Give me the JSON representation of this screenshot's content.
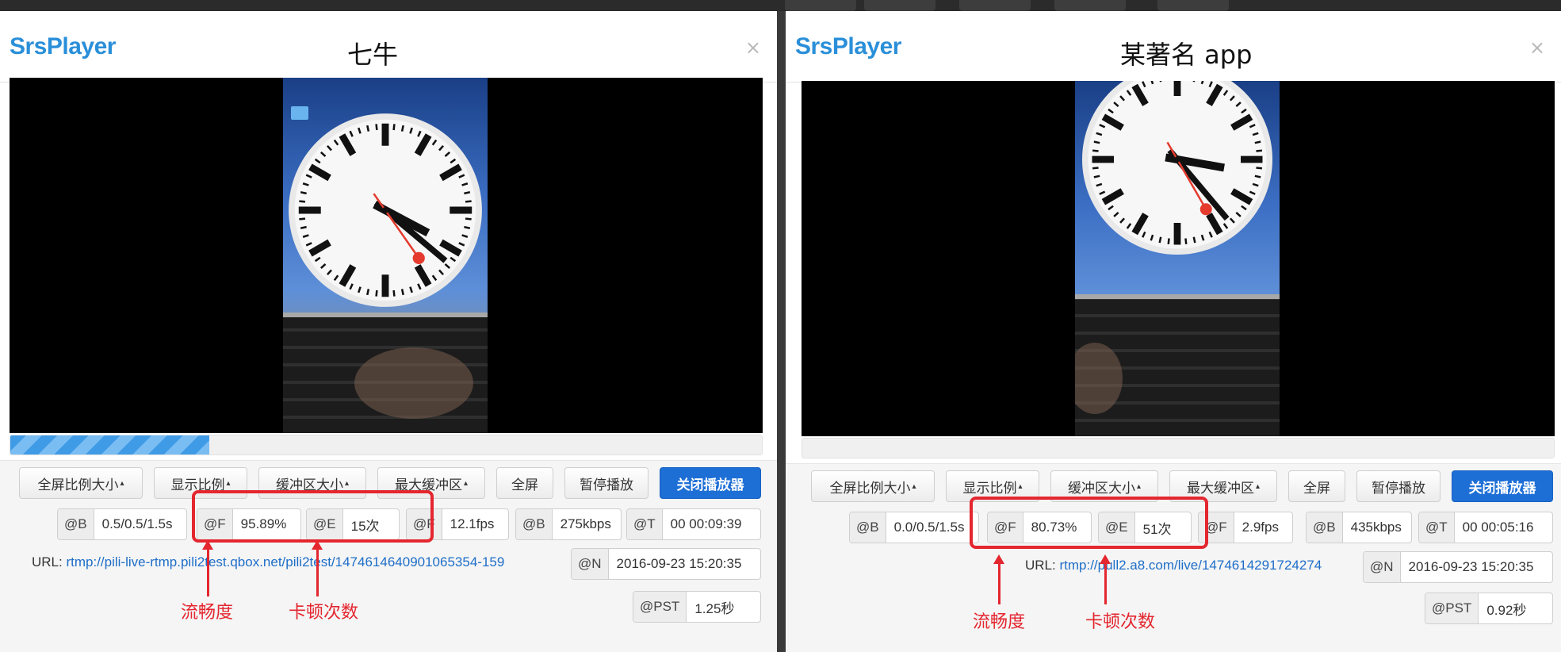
{
  "panels": [
    {
      "logo": "SrsPlayer",
      "caption": "七牛",
      "close": "×",
      "progress_fraction": 0.265,
      "buttons": [
        "全屏比例大小",
        "显示比例",
        "缓冲区大小",
        "最大缓冲区",
        "全屏",
        "暂停播放",
        "关闭播放器"
      ],
      "dropdown_caret": "▴",
      "stats": {
        "buffer": {
          "label": "@B",
          "value": "0.5/0.5/1.5s"
        },
        "fluency": {
          "label": "@F",
          "value": "95.89%"
        },
        "stalls": {
          "label": "@E",
          "value": "15次"
        },
        "fps": {
          "label": "@F",
          "value": "12.1fps"
        },
        "bitrate": {
          "label": "@B",
          "value": "275kbps"
        },
        "time": {
          "label": "@T",
          "value": "00 00:09:39"
        },
        "date": {
          "label": "@N",
          "value": "2016-09-23 15:20:35"
        },
        "pst": {
          "label": "@PST",
          "value": "1.25秒"
        }
      },
      "url_label": "URL:",
      "url": "rtmp://pili-live-rtmp.pili2test.qbox.net/pili2test/1474614640901065354-159",
      "annotations": {
        "fluency": "流畅度",
        "stalls": "卡顿次数"
      }
    },
    {
      "logo": "SrsPlayer",
      "caption": "某著名 app",
      "close": "×",
      "progress_fraction": 0,
      "buttons": [
        "全屏比例大小",
        "显示比例",
        "缓冲区大小",
        "最大缓冲区",
        "全屏",
        "暂停播放",
        "关闭播放器"
      ],
      "dropdown_caret": "▴",
      "stats": {
        "buffer": {
          "label": "@B",
          "value": "0.0/0.5/1.5s"
        },
        "fluency": {
          "label": "@F",
          "value": "80.73%"
        },
        "stalls": {
          "label": "@E",
          "value": "51次"
        },
        "fps": {
          "label": "@F",
          "value": "2.9fps"
        },
        "bitrate": {
          "label": "@B",
          "value": "435kbps"
        },
        "time": {
          "label": "@T",
          "value": "00 00:05:16"
        },
        "date": {
          "label": "@N",
          "value": "2016-09-23 15:20:35"
        },
        "pst": {
          "label": "@PST",
          "value": "0.92秒"
        }
      },
      "url_label": "URL:",
      "url": "rtmp://pull2.a8.com/live/1474614291724274",
      "annotations": {
        "fluency": "流畅度",
        "stalls": "卡顿次数"
      }
    }
  ],
  "colors": {
    "accent": "#1d6fd6",
    "logo": "#2a8fd9",
    "annotation": "#e4262f",
    "link": "#1e6ec8"
  },
  "icons": [
    "close-icon",
    "caret-up-icon",
    "clock-icon"
  ]
}
